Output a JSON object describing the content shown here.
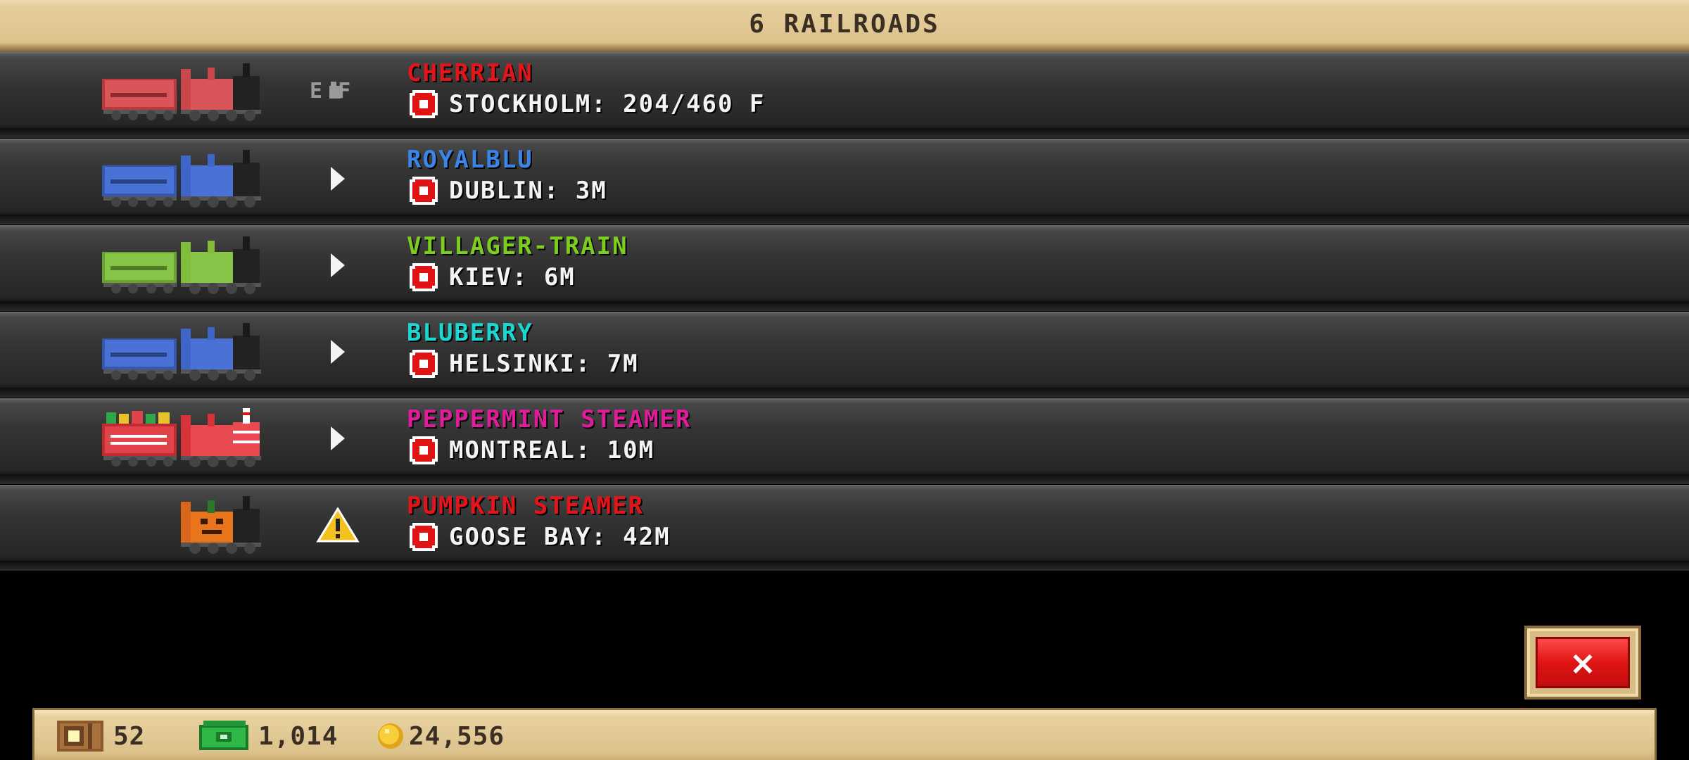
{
  "header": {
    "title": "6 RAILROADS"
  },
  "railroads": [
    {
      "name": "CHERRIAN",
      "name_color": "#e5141a",
      "route": "STOCKHOLM: 204/460 F",
      "status": "ef-indicator",
      "status_label": "E F",
      "train_color": "#c9474a",
      "train_type": "engine-and-tender"
    },
    {
      "name": "ROYALBLU",
      "name_color": "#3a86e8",
      "route": "DUBLIN: 3M",
      "status": "play-arrow",
      "train_color": "#3e66c8",
      "train_type": "engine-and-tender"
    },
    {
      "name": "VILLAGER-TRAIN",
      "name_color": "#7ccd1e",
      "route": "KIEV: 6M",
      "status": "play-arrow",
      "train_color": "#7fbd3b",
      "train_type": "engine-and-tender"
    },
    {
      "name": "BLUBERRY",
      "name_color": "#1ad7d2",
      "route": "HELSINKI: 7M",
      "status": "play-arrow",
      "train_color": "#3e66c8",
      "train_type": "engine-and-tender"
    },
    {
      "name": "PEPPERMINT STEAMER",
      "name_color": "#e01c9a",
      "route": "MONTREAL: 10M",
      "status": "play-arrow",
      "train_color": "#d8323a",
      "train_type": "peppermint"
    },
    {
      "name": "PUMPKIN STEAMER",
      "name_color": "#e5141a",
      "route": "GOOSE BAY: 42M",
      "status": "warning",
      "train_color": "#e8741c",
      "train_type": "pumpkin-engine"
    }
  ],
  "close_button": {
    "label": "×"
  },
  "footer": {
    "crates": "52",
    "cash": "1,014",
    "coins": "24,556"
  },
  "colors": {
    "header_bg": "#e2cb97",
    "row_bg": "#333333",
    "accent_red": "#e01414"
  }
}
